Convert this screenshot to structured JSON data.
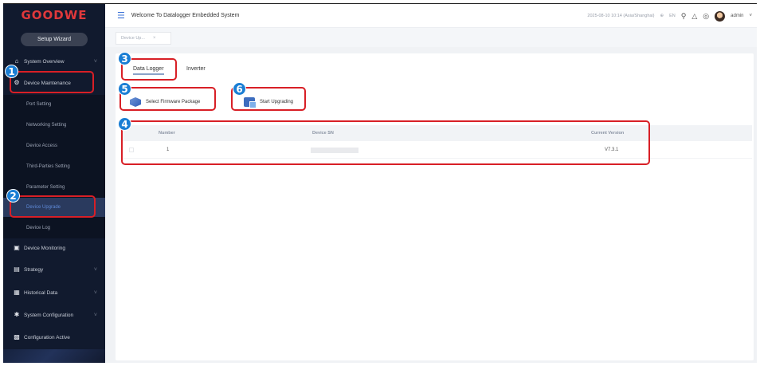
{
  "sidebar": {
    "logo": "GOODWE",
    "setup_wizard": "Setup Wizard",
    "items": [
      {
        "label": "System Overview",
        "icon": "home-icon",
        "chevron": "˅"
      },
      {
        "label": "Device Maintenance",
        "icon": "wrench-icon"
      },
      {
        "label": "Port Setting"
      },
      {
        "label": "Networking Setting"
      },
      {
        "label": "Device Access"
      },
      {
        "label": "Third-Parties Setting"
      },
      {
        "label": "Parameter Setting"
      },
      {
        "label": "Device Upgrade"
      },
      {
        "label": "Device Log"
      },
      {
        "label": "Device Monitoring",
        "icon": "monitor-icon"
      },
      {
        "label": "Strategy",
        "icon": "strategy-icon",
        "chevron": "˅"
      },
      {
        "label": "Historical Data",
        "icon": "history-icon",
        "chevron": "˅"
      },
      {
        "label": "System Configuration",
        "icon": "settings-icon",
        "chevron": "˅"
      },
      {
        "label": "Configuration Active",
        "icon": "config-icon"
      }
    ]
  },
  "header": {
    "menu_icon": "☰",
    "title": "Welcome To Datalogger Embedded System",
    "datetime": "2025-08-10 10:14 (Asia/Shanghai)",
    "language": "EN",
    "user": "admin"
  },
  "page_tab": {
    "label": "Device Up...",
    "close": "×"
  },
  "main": {
    "tabs": [
      {
        "label": "Data Logger",
        "active": true
      },
      {
        "label": "Inverter",
        "active": false
      }
    ],
    "buttons": {
      "select_package": "Select Firmware Package",
      "start_upgrading": "Start Upgrading"
    },
    "table": {
      "columns": [
        "Number",
        "Device SN",
        "Current Version"
      ],
      "rows": [
        {
          "number": "1",
          "sn": "",
          "version": "V7.3.1"
        }
      ]
    }
  },
  "callouts": [
    "1",
    "2",
    "3",
    "4",
    "5",
    "6"
  ],
  "colors": {
    "sidebar_bg": "#111a2e",
    "active_item": "#2a3a5e",
    "highlight": "#d81f26",
    "badge": "#1a7ed4",
    "brand": "#e0383b"
  }
}
